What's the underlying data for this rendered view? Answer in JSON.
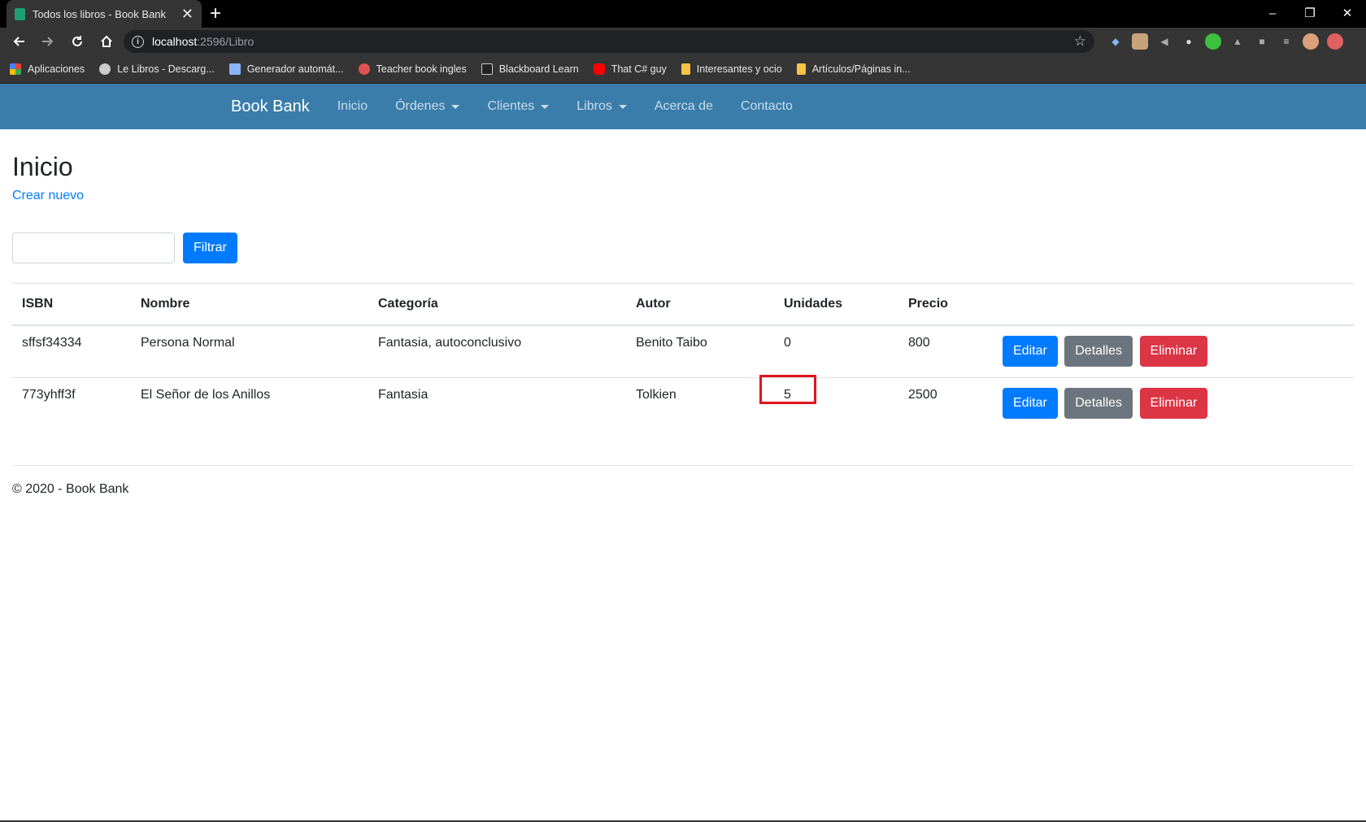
{
  "browser": {
    "tab_title": "Todos los libros - Book Bank",
    "tab_close": "✕",
    "new_tab": "+",
    "window_controls": [
      "–",
      "❐",
      "✕"
    ],
    "url_host": "localhost",
    "url_path": ":2596/Libro",
    "bookmarks": [
      {
        "label": "Aplicaciones",
        "icon": "apps-grid-icon",
        "color": "#e94235"
      },
      {
        "label": "Le Libros - Descarg...",
        "icon": "globe-icon",
        "color": "#cccccc"
      },
      {
        "label": "Generador automát...",
        "icon": "doc-icon",
        "color": "#8ab4f8"
      },
      {
        "label": "Teacher book ingles",
        "icon": "target-icon",
        "color": "#e0524f"
      },
      {
        "label": "Blackboard Learn",
        "icon": "bb-icon",
        "color": "#222222"
      },
      {
        "label": "That C# guy",
        "icon": "youtube-icon",
        "color": "#ff0000"
      },
      {
        "label": "Interesantes y ocio",
        "icon": "folder-icon",
        "color": "#f6c445"
      },
      {
        "label": "Artículos/Páginas in...",
        "icon": "folder-icon",
        "color": "#f6c445"
      }
    ]
  },
  "navbar": {
    "brand": "Book Bank",
    "links": [
      {
        "label": "Inicio",
        "dropdown": false
      },
      {
        "label": "Órdenes",
        "dropdown": true
      },
      {
        "label": "Clientes",
        "dropdown": true
      },
      {
        "label": "Libros",
        "dropdown": true
      },
      {
        "label": "Acerca de",
        "dropdown": false
      },
      {
        "label": "Contacto",
        "dropdown": false
      }
    ]
  },
  "page": {
    "title": "Inicio",
    "create_link": "Crear nuevo",
    "filter_value": "",
    "filter_button": "Filtrar"
  },
  "table": {
    "headers": [
      "ISBN",
      "Nombre",
      "Categoría",
      "Autor",
      "Unidades",
      "Precio",
      ""
    ],
    "rows": [
      {
        "isbn": "sffsf34334",
        "nombre": "Persona Normal",
        "categoria": "Fantasia, autoconclusivo",
        "autor": "Benito Taibo",
        "unidades": "0",
        "precio": "800"
      },
      {
        "isbn": "773yhff3f",
        "nombre": "El Señor de los Anillos",
        "categoria": "Fantasia",
        "autor": "Tolkien",
        "unidades": "5",
        "precio": "2500"
      }
    ],
    "actions": {
      "edit": "Editar",
      "details": "Detalles",
      "delete": "Eliminar"
    }
  },
  "footer": {
    "text": "© 2020 - Book Bank"
  },
  "colors": {
    "navbar": "#3a7dab",
    "primary": "#007bff",
    "secondary": "#6c757d",
    "danger": "#dc3545",
    "highlight": "#e0141e"
  }
}
